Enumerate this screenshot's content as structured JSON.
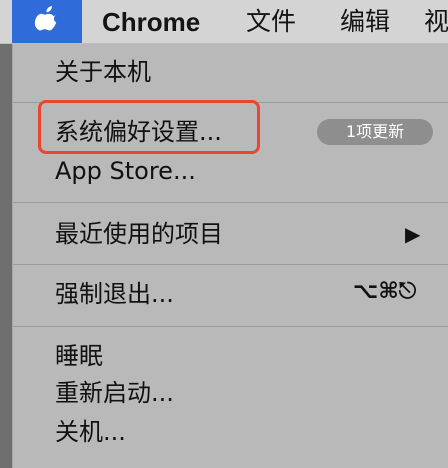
{
  "menubar": {
    "app_name": "Chrome",
    "file": "文件",
    "edit": "编辑",
    "view": "视",
    "apple_menu_color": "#2f6bd9"
  },
  "apple_menu": {
    "items": [
      {
        "label": "关于本机"
      },
      {
        "label": "系统偏好设置...",
        "badge": "1项更新",
        "highlighted": true
      },
      {
        "label": "App Store..."
      },
      {
        "label": "最近使用的项目",
        "submenu_arrow": "▶"
      },
      {
        "label": "强制退出...",
        "shortcut": "⌥⌘⎋"
      },
      {
        "label": "睡眠"
      },
      {
        "label": "重新启动..."
      },
      {
        "label": "关机..."
      }
    ]
  },
  "colors": {
    "highlight_border": "#e8462e",
    "menu_background": "#b9b9b9"
  }
}
